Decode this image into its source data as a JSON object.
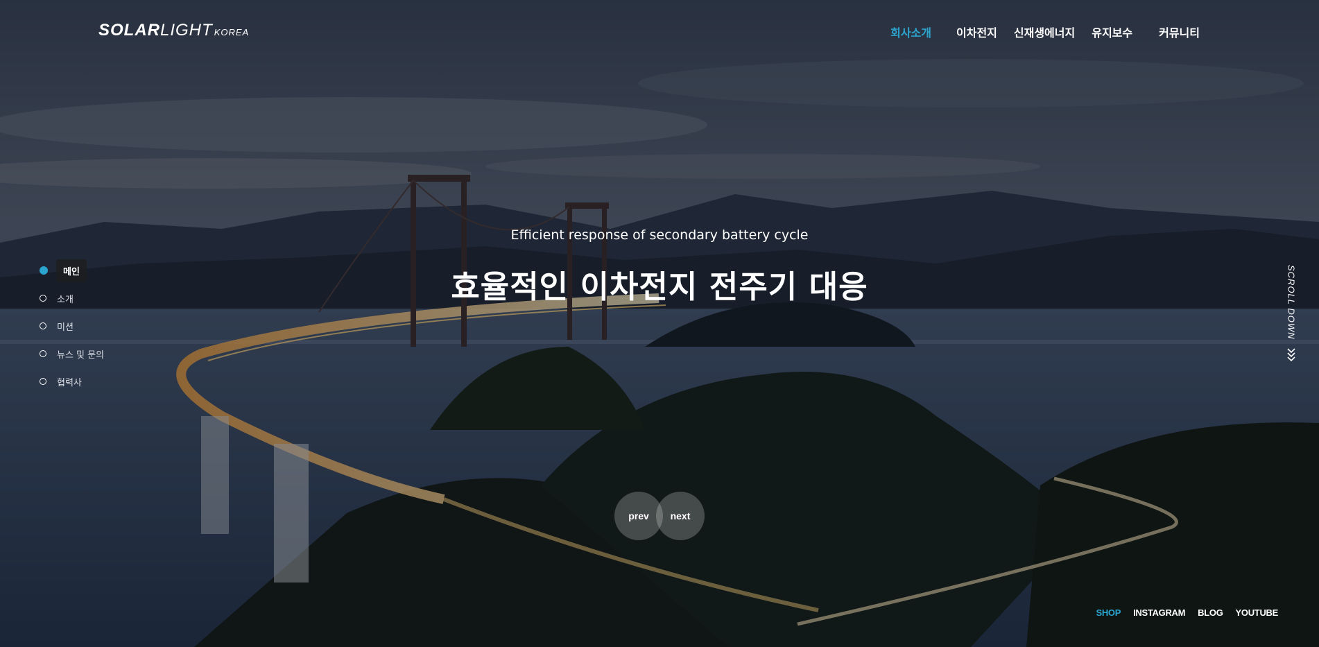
{
  "header": {
    "logo": {
      "main_bold": "SOLAR",
      "main_light": "LIGHT",
      "sub": "KOREA"
    },
    "nav": [
      {
        "label": "회사소개",
        "active": true
      },
      {
        "label": "이차전지",
        "active": false
      },
      {
        "label": "신재생에너지",
        "active": false
      },
      {
        "label": "유지보수",
        "active": false
      },
      {
        "label": "커뮤니티",
        "active": false
      }
    ]
  },
  "side_nav": [
    {
      "label": "메인",
      "active": true
    },
    {
      "label": "소개",
      "active": false
    },
    {
      "label": "미션",
      "active": false
    },
    {
      "label": "뉴스 및 문의",
      "active": false
    },
    {
      "label": "협력사",
      "active": false
    }
  ],
  "hero": {
    "subtitle": "Efficient response of secondary battery cycle",
    "title": "효율적인 이차전지 전주기 대응"
  },
  "scroll": {
    "label": "SCROLL DOWN"
  },
  "pager": {
    "prev": "prev",
    "next": "next"
  },
  "social": [
    {
      "label": "SHOP",
      "active": true
    },
    {
      "label": "INSTAGRAM",
      "active": false
    },
    {
      "label": "BLOG",
      "active": false
    },
    {
      "label": "YOUTUBE",
      "active": false
    }
  ],
  "colors": {
    "accent": "#2ba5cf",
    "text": "#ffffff"
  },
  "background_image": {
    "subject": "suspension bridge over bay at dusk with light trails"
  }
}
